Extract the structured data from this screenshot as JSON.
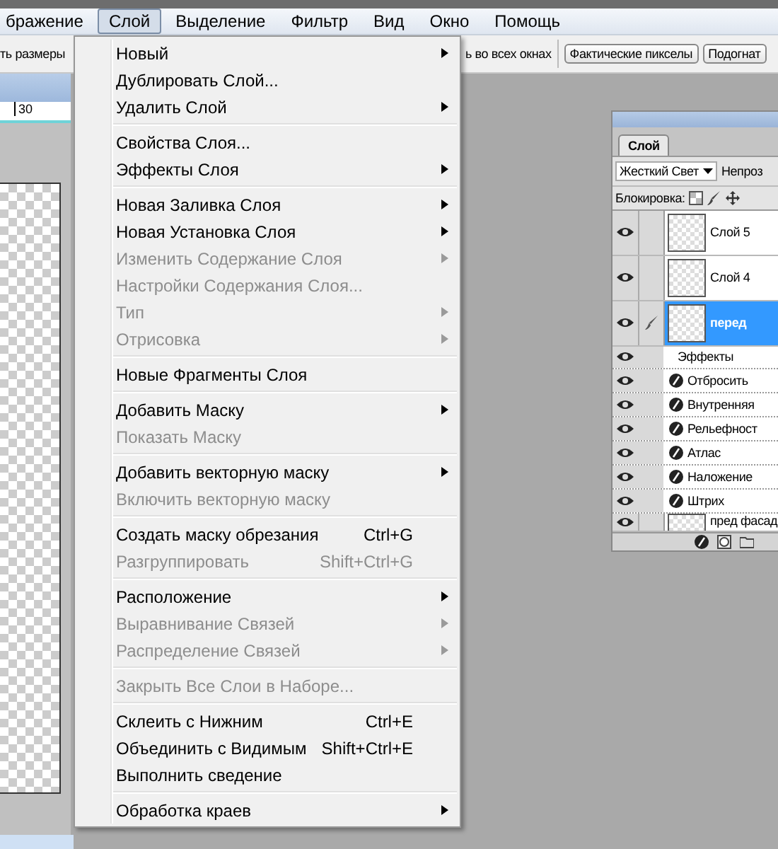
{
  "menubar": [
    {
      "label": "бражение",
      "selected": false
    },
    {
      "label": "Слой",
      "selected": true
    },
    {
      "label": "Выделение",
      "selected": false
    },
    {
      "label": "Фильтр",
      "selected": false
    },
    {
      "label": "Вид",
      "selected": false
    },
    {
      "label": "Окно",
      "selected": false
    },
    {
      "label": "Помощь",
      "selected": false
    }
  ],
  "options_bar": {
    "text_left": "ть размеры",
    "text_right": "ь во всех окнах",
    "buttons": [
      "Фактические пикселы",
      "Подогнат"
    ]
  },
  "document": {
    "ruler_mark": "30"
  },
  "layer_menu": {
    "groups": [
      {
        "items": [
          {
            "label": "Новый",
            "submenu": true,
            "disabled": false
          },
          {
            "label": "Дублировать Слой...",
            "submenu": false,
            "disabled": false
          },
          {
            "label": "Удалить Слой",
            "submenu": true,
            "disabled": false
          }
        ]
      },
      {
        "items": [
          {
            "label": "Свойства Слоя...",
            "submenu": false,
            "disabled": false
          },
          {
            "label": "Эффекты Слоя",
            "submenu": true,
            "disabled": false
          }
        ]
      },
      {
        "items": [
          {
            "label": "Новая Заливка Слоя",
            "submenu": true,
            "disabled": false
          },
          {
            "label": "Новая Установка Слоя",
            "submenu": true,
            "disabled": false
          },
          {
            "label": "Изменить Содержание Слоя",
            "submenu": true,
            "disabled": true
          },
          {
            "label": "Настройки Содержания Слоя...",
            "submenu": false,
            "disabled": true
          },
          {
            "label": "Тип",
            "submenu": true,
            "disabled": true
          },
          {
            "label": "Отрисовка",
            "submenu": true,
            "disabled": true
          }
        ]
      },
      {
        "items": [
          {
            "label": "Новые Фрагменты Слоя",
            "submenu": false,
            "disabled": false
          }
        ]
      },
      {
        "items": [
          {
            "label": "Добавить Маску",
            "submenu": true,
            "disabled": false
          },
          {
            "label": "Показать Маску",
            "submenu": false,
            "disabled": true
          }
        ]
      },
      {
        "items": [
          {
            "label": "Добавить векторную маску",
            "submenu": true,
            "disabled": false
          },
          {
            "label": "Включить векторную маску",
            "submenu": false,
            "disabled": true
          }
        ]
      },
      {
        "items": [
          {
            "label": "Создать маску обрезания",
            "shortcut": "Ctrl+G",
            "submenu": false,
            "disabled": false
          },
          {
            "label": "Разгруппировать",
            "shortcut": "Shift+Ctrl+G",
            "submenu": false,
            "disabled": true
          }
        ]
      },
      {
        "items": [
          {
            "label": "Расположение",
            "submenu": true,
            "disabled": false
          },
          {
            "label": "Выравнивание Связей",
            "submenu": true,
            "disabled": true
          },
          {
            "label": "Распределение Связей",
            "submenu": true,
            "disabled": true
          }
        ]
      },
      {
        "items": [
          {
            "label": "Закрыть Все Слои в Наборе...",
            "submenu": false,
            "disabled": true
          }
        ]
      },
      {
        "items": [
          {
            "label": "Склеить с Нижним",
            "shortcut": "Ctrl+E",
            "submenu": false,
            "disabled": false
          },
          {
            "label": "Объединить с Видимым",
            "shortcut": "Shift+Ctrl+E",
            "submenu": false,
            "disabled": false
          },
          {
            "label": "Выполнить сведение",
            "submenu": false,
            "disabled": false
          }
        ]
      },
      {
        "items": [
          {
            "label": "Обработка краев",
            "submenu": true,
            "disabled": false
          }
        ]
      }
    ]
  },
  "layers_panel": {
    "tab": "Слой",
    "blend_mode": "Жесткий Свет",
    "opacity_label": "Непроз",
    "lock_label": "Блокировка:",
    "layers": [
      {
        "name": "Слой 5",
        "visible": true,
        "selected": false
      },
      {
        "name": "Слой 4",
        "visible": true,
        "selected": false
      },
      {
        "name": "перед",
        "visible": true,
        "selected": true,
        "effects_label": "Эффекты",
        "effects": [
          {
            "name": "Отбросить",
            "visible": true
          },
          {
            "name": "Внутренняя",
            "visible": true
          },
          {
            "name": "Рельефност",
            "visible": true
          },
          {
            "name": "Атлас",
            "visible": true
          },
          {
            "name": "Наложение",
            "visible": true
          },
          {
            "name": "Штрих",
            "visible": true
          }
        ]
      },
      {
        "name": "пред фасад",
        "visible": true,
        "selected": false
      }
    ]
  }
}
